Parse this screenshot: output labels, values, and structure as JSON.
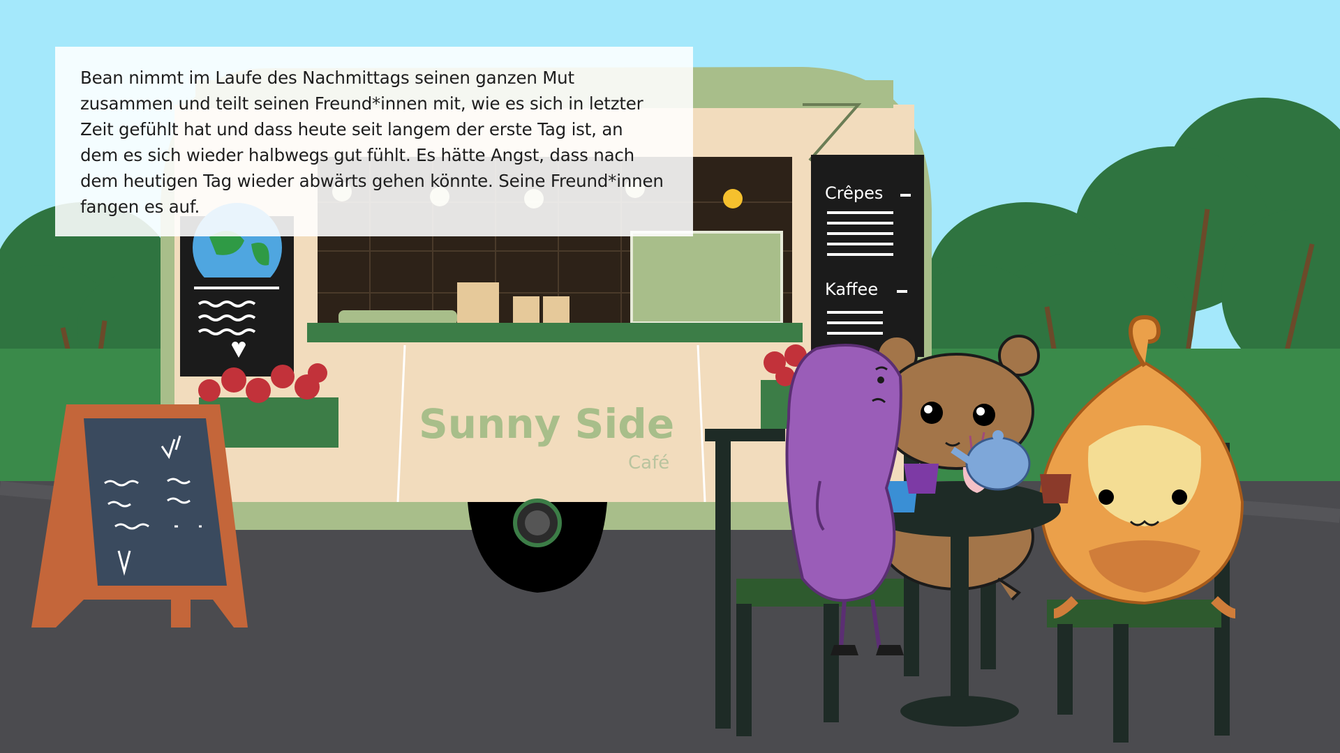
{
  "story": {
    "text": "Bean nimmt im Laufe des Nachmittags seinen ganzen Mut zusammen und teilt seinen Freund*innen mit, wie es sich in letzter Zeit gefühlt hat und dass heute seit langem der erste Tag ist, an dem es sich wieder halbwegs gut fühlt. Es hätte Angst, dass nach dem heutigen Tag wieder abwärts gehen könnte. Seine Freund*innen fangen es auf."
  },
  "truck": {
    "name": "Sunny Side",
    "subname": "Café",
    "menu_items": [
      "Crêpes",
      "Kaffee"
    ]
  },
  "colors": {
    "sky": "#a4e8fb",
    "ground": "#4b4b4f",
    "truck_body": "#f2dcbd",
    "truck_green": "#a8be8a",
    "bean_purple": "#9a5db8",
    "bear_brown": "#a37549",
    "onion_orange": "#eba04a"
  },
  "icons": [
    "globe-icon",
    "heart-icon",
    "teapot-icon",
    "cup-icon",
    "chalkboard-sign"
  ]
}
